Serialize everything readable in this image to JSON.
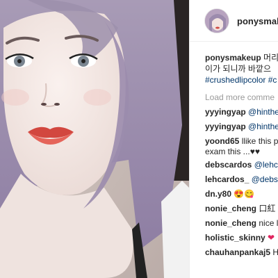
{
  "post": {
    "username": "ponysmake",
    "caption_user": "ponysmakeup",
    "caption_line1": "머리",
    "caption_line2": "이가 되니까 바깥으",
    "caption_tags": "#crushedlipcolor #c",
    "load_more": "Load more comme"
  },
  "comments": [
    {
      "user": "yyyingyap",
      "text": "@hinthe"
    },
    {
      "user": "yyyingyap",
      "text": "@hinthe"
    },
    {
      "user": "yoond65",
      "text": "llike this p",
      "text2": "exam this ...♥♥"
    },
    {
      "user": "debscardos",
      "text": "@lehca"
    },
    {
      "user": "lehcardos_",
      "text": "@debsc"
    },
    {
      "user": "dn.y80",
      "text": "😍😋"
    },
    {
      "user": "nonie_cheng",
      "text": "口紅"
    },
    {
      "user": "nonie_cheng",
      "text": "nice l"
    },
    {
      "user": "holistic_skinny",
      "text": "❤"
    },
    {
      "user": "chauhanpankaj5",
      "text": "H"
    }
  ]
}
